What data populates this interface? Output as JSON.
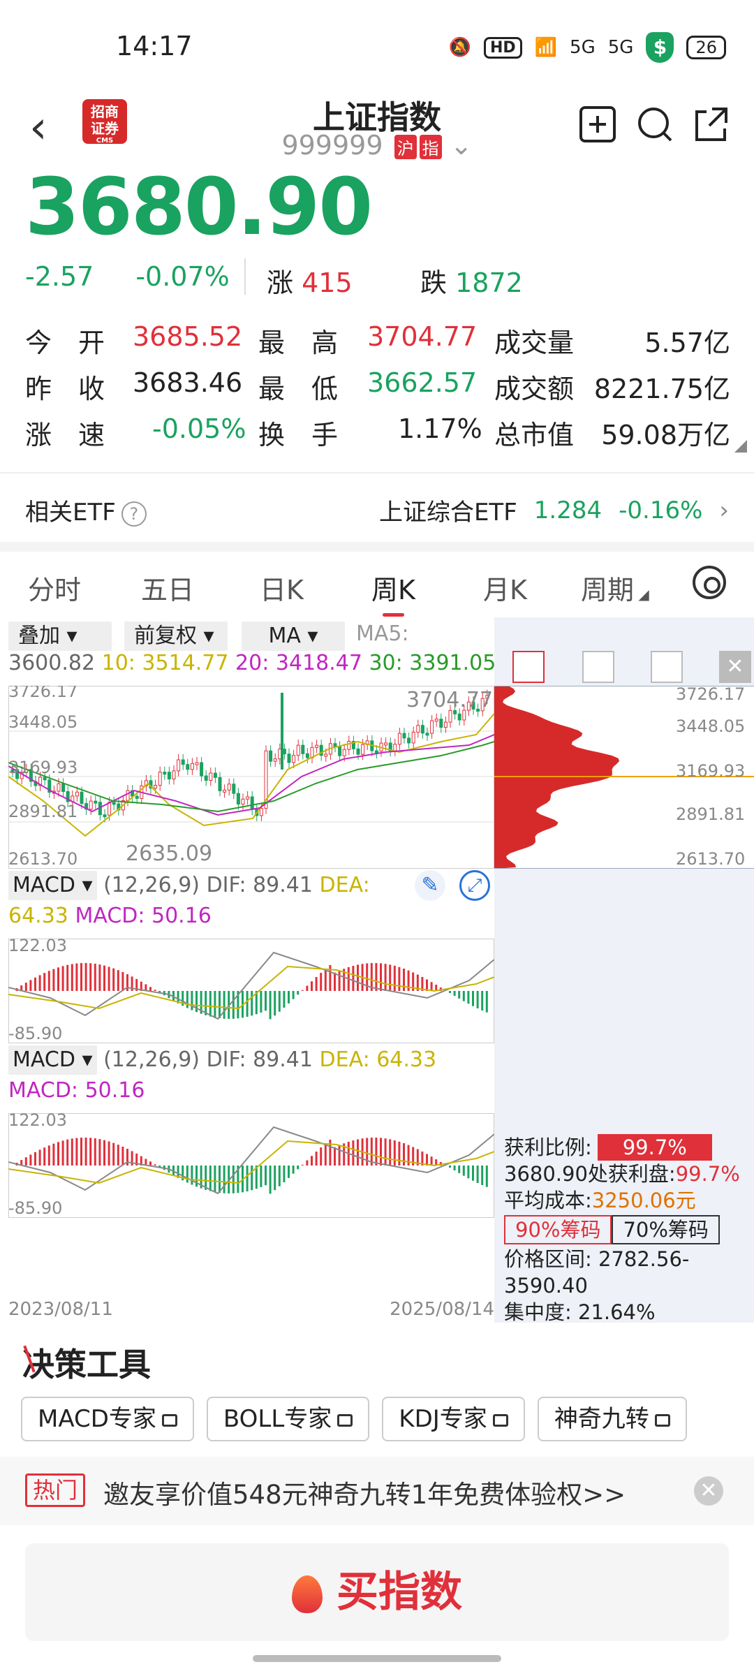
{
  "status": {
    "time": "14:17",
    "hd": "HD",
    "net1": "5G",
    "net2": "5G",
    "battery": "26"
  },
  "header": {
    "back": "‹",
    "logo_top": "招商",
    "logo_bottom": "证券",
    "logo_sub": "CMS",
    "title": "上证指数",
    "code": "999999",
    "tag1": "沪",
    "tag2": "指"
  },
  "quote": {
    "price": "3680.90",
    "change": "-2.57",
    "change_pct": "-0.07%",
    "up_label": "涨",
    "up_count": "415",
    "down_label": "跌",
    "down_count": "1872"
  },
  "stats": {
    "open_label": "今　开",
    "open": "3685.52",
    "high_label": "最　高",
    "high": "3704.77",
    "vol_label": "成交量",
    "vol": "5.57亿",
    "prev_label": "昨　收",
    "prev": "3683.46",
    "low_label": "最　低",
    "low": "3662.57",
    "amt_label": "成交额",
    "amt": "8221.75亿",
    "speed_label": "涨　速",
    "speed": "-0.05%",
    "turn_label": "换　手",
    "turn": "1.17%",
    "cap_label": "总市值",
    "cap": "59.08万亿"
  },
  "etf": {
    "label": "相关ETF",
    "name": "上证综合ETF",
    "price": "1.284",
    "pct": "-0.16%"
  },
  "tabs": [
    "分时",
    "五日",
    "日K",
    "周K",
    "月K",
    "周期"
  ],
  "chart_ctrl": {
    "overlay": "叠加",
    "adjust": "前复权",
    "ma": "MA",
    "ma5_label": "MA5:"
  },
  "ma_values": {
    "ma5": "3600.82",
    "ma10": "10: 3514.77",
    "ma20": "20: 3418.47",
    "ma30": "30: 3391.05"
  },
  "kline_axis": [
    "3726.17",
    "3448.05",
    "3169.93",
    "2891.81",
    "2613.70"
  ],
  "kline_marks": {
    "high": "3704.77",
    "low": "2635.09"
  },
  "macd1": {
    "label": "MACD",
    "params": "(12,26,9)",
    "dif": "DIF: 89.41",
    "dea": "DEA:",
    "dea_val": "64.33",
    "macd": "MACD: 50.16",
    "top": "122.03",
    "bottom": "-85.90"
  },
  "macd2": {
    "label": "MACD",
    "params": "(12,26,9)",
    "dif": "DIF: 89.41",
    "dea": "DEA: 64.33",
    "macd": "MACD: 50.16",
    "top": "122.03",
    "bottom": "-85.90"
  },
  "dates": {
    "start": "2023/08/11",
    "end": "2025/08/14"
  },
  "chips": {
    "profit_label": "获利比例:",
    "profit": "99.7%",
    "profit_line": "3680.90处获利盘:",
    "profit_line_val": "99.7%",
    "avg_label": "平均成本:",
    "avg": "3250.06元",
    "btn90": "90%筹码",
    "btn70": "70%筹码",
    "range": "价格区间: 2782.56-3590.40",
    "conc": "集中度: 21.64%"
  },
  "tools": {
    "title": "决策工具",
    "items": [
      "MACD专家",
      "BOLL专家",
      "KDJ专家",
      "神奇九转"
    ]
  },
  "promo": {
    "tag": "热门",
    "text": "邀友享价值548元神奇九转1年免费体验权>>"
  },
  "buy": {
    "label": "买指数"
  },
  "colors": {
    "red": "#e0303a",
    "green": "#1aa260"
  }
}
